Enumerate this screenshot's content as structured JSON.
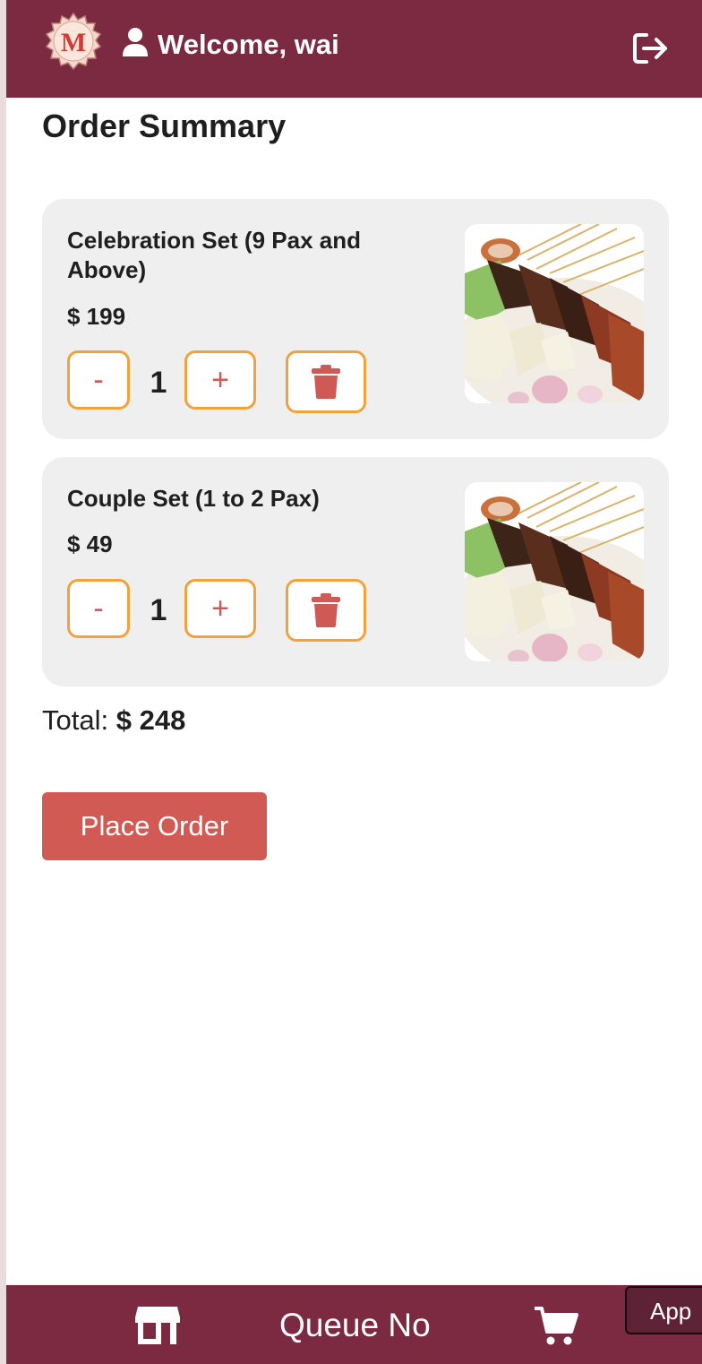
{
  "header": {
    "logo_letter": "M",
    "welcome_text": "Welcome, wai",
    "logout_icon": "logout-icon",
    "user_icon": "user-icon",
    "color": "#7b2a42"
  },
  "page": {
    "title": "Order Summary"
  },
  "cart": {
    "items": [
      {
        "name": "Celebration Set (9 Pax and Above)",
        "price": "$ 199",
        "quantity": "1",
        "decrement_label": "-",
        "increment_label": "+",
        "delete_icon": "trash-icon"
      },
      {
        "name": "Couple Set (1 to 2 Pax)",
        "price": "$ 49",
        "quantity": "1",
        "decrement_label": "-",
        "increment_label": "+",
        "delete_icon": "trash-icon"
      }
    ],
    "total_label": "Total:",
    "total_value": "$ 248"
  },
  "actions": {
    "place_order_label": "Place Order",
    "accent": "#d25a55",
    "button_border": "#f0a23c"
  },
  "bottom_nav": {
    "store_icon": "store-icon",
    "queue_label": "Queue No",
    "cart_icon": "cart-icon",
    "app_label": "App"
  }
}
